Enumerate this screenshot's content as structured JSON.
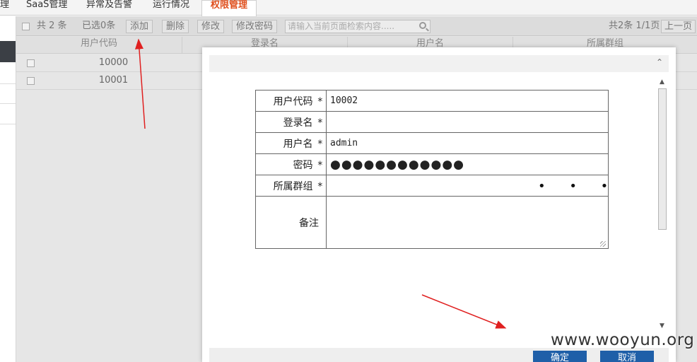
{
  "nav": {
    "tabs": [
      {
        "label": "理"
      },
      {
        "label": "SaaS管理"
      },
      {
        "label": "异常及告警"
      },
      {
        "label": "运行情况"
      },
      {
        "label": "权限管理"
      }
    ],
    "active_color": "#e0501e"
  },
  "toolbar": {
    "total": "共 2 条",
    "selected": "已选0条",
    "add": "添加",
    "delete": "删除",
    "edit": "修改",
    "change_password": "修改密码",
    "search_placeholder": "请输入当前页面检索内容.....",
    "pager_info": "共2条 1/1页",
    "prev": "上一页"
  },
  "table": {
    "columns": [
      "用户代码",
      "登录名",
      "用户名",
      "所属群组"
    ],
    "rows": [
      [
        "10000"
      ],
      [
        "10001"
      ]
    ]
  },
  "dialog": {
    "fields": [
      {
        "label": "用户代码",
        "required": "*",
        "value": "10002"
      },
      {
        "label": "登录名",
        "required": "*",
        "value": ""
      },
      {
        "label": "用户名",
        "required": "*",
        "value": "admin"
      },
      {
        "label": "密码",
        "required": "*",
        "value": "●●●●●●●●●●●●"
      },
      {
        "label": "所属群组",
        "required": "*",
        "value": ""
      },
      {
        "label": "备注",
        "required": "",
        "value": ""
      }
    ],
    "ellipsis": "• • •",
    "confirm": "确定",
    "cancel": "取消",
    "button_color": "#1f5fa8"
  },
  "watermark": "www.wooyun.org"
}
